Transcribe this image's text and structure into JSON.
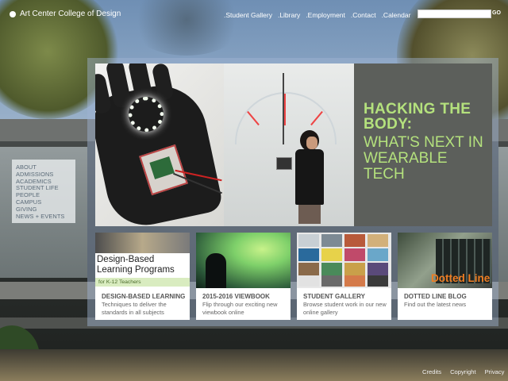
{
  "header": {
    "logo_text": "Art Center College of Design",
    "nav": [
      ".Student Gallery",
      ".Library",
      ".Employment",
      ".Contact",
      ".Calendar"
    ],
    "search_value": "",
    "go_label": "GO"
  },
  "sidemenu": [
    "ABOUT",
    "ADMISSIONS",
    "ACADEMICS",
    "STUDENT LIFE",
    "PEOPLE",
    "CAMPUS",
    "GIVING",
    "NEWS + EVENTS"
  ],
  "hero": {
    "headline": "HACKING THE BODY:",
    "subhead": "WHAT'S NEXT IN WEARABLE TECH",
    "accent_color": "#b4e17d"
  },
  "cards": [
    {
      "thumb_heading": "Design-Based Learning Programs",
      "thumb_sub": "for K-12 Teachers",
      "title": "DESIGN-BASED LEARNING",
      "desc": "Techniques to deliver the standards in all subjects"
    },
    {
      "title": "2015-2016 VIEWBOOK",
      "desc": "Flip through our exciting new viewbook online"
    },
    {
      "title": "STUDENT GALLERY",
      "desc": "Browse student work in our new online gallery"
    },
    {
      "thumb_label": "Dotted Line",
      "title": "DOTTED LINE BLOG",
      "desc": "Find out the latest news"
    }
  ],
  "footer": [
    "Credits",
    "Copyright",
    "Privacy"
  ]
}
